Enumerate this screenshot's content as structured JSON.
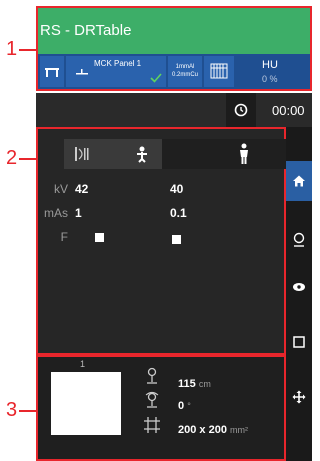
{
  "callouts": [
    "1",
    "2",
    "3"
  ],
  "header": {
    "title": "RS - DRTable",
    "panel_name": "MCK Panel 1",
    "filter_line1": "1mmAl",
    "filter_line2": "0.2mmCu",
    "hu_label": "HU",
    "hu_value": "0 %"
  },
  "timer": {
    "value": "00:00"
  },
  "exposure": {
    "kv_label": "kV",
    "mas_label": "mAs",
    "f_label": "F",
    "col1": {
      "kv": "42",
      "mas": "1",
      "f_checked": true
    },
    "col2": {
      "kv": "40",
      "mas": "0.1",
      "f_checked": true
    }
  },
  "geometry": {
    "image_number": "1",
    "sid_value": "115",
    "sid_unit": "cm",
    "angle_value": "0",
    "angle_unit": "°",
    "field_value": "200 x 200",
    "field_unit": "mm²"
  },
  "sidebar": [
    "home-icon",
    "person-outline-icon",
    "eye-icon",
    "square-icon",
    "move-icon"
  ],
  "colors": {
    "accent_green": "#3dae68",
    "info_blue": "#1f4f91",
    "callout_red": "#e8262c",
    "sidebar_active": "#2a5fa3"
  }
}
